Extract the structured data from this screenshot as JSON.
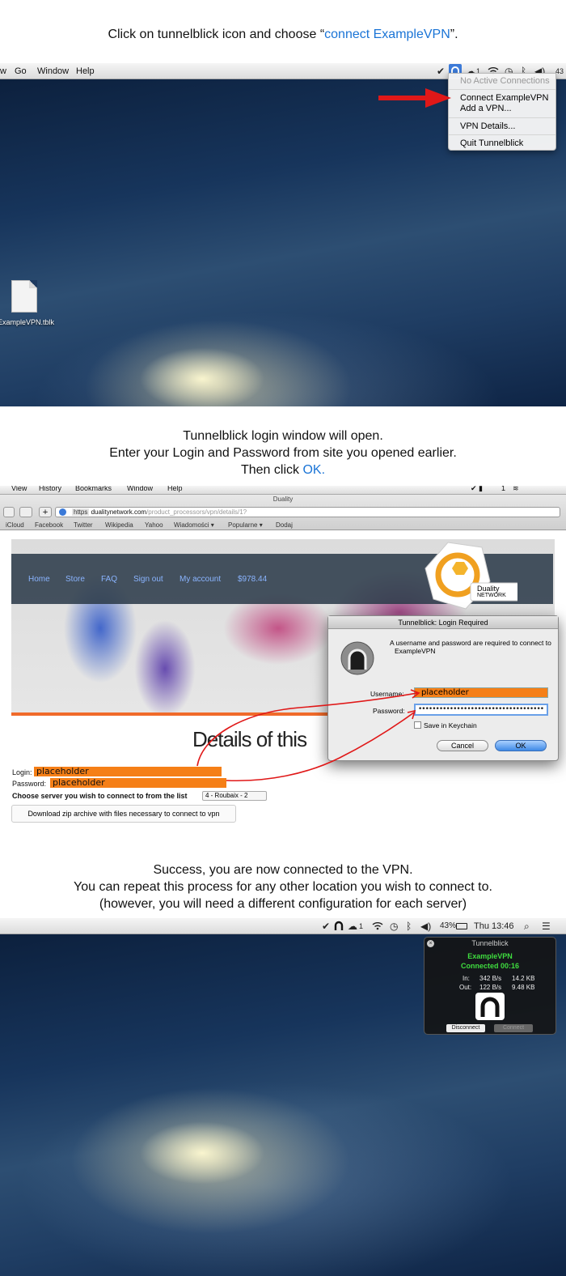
{
  "captions": {
    "step1_pre": "Click on tunnelblick icon and choose “",
    "step1_hl": "connect ExampleVPN",
    "step1_post": "”.",
    "step2_line1": "Tunnelblick login window will open.",
    "step2_line2": "Enter your Login and Password from site you opened earlier.",
    "step2_line3_pre": "Then click ",
    "step2_line3_hl": "OK.",
    "step3_line1": "Success, you are now connected to the VPN.",
    "step3_line2": "You can repeat this process for any other location you wish to connect to.",
    "step3_line3": "(however, you will need a different configuration for each server)"
  },
  "colors": {
    "highlight": "#1a74d6",
    "orange": "#f57f17",
    "arrow": "#e01818",
    "connected_green": "#3fdc3f"
  },
  "screen1": {
    "menubar": [
      "w",
      "Go",
      "Window",
      "Help"
    ],
    "tray_badge": "1",
    "tray_right": "43",
    "tunnelblick_menu": {
      "items": [
        "No Active Connections",
        "Connect ExampleVPN",
        "Add a VPN...",
        "VPN Details...",
        "Quit Tunnelblick"
      ]
    },
    "desktop_file": "ExampleVPN.tblk"
  },
  "screen2": {
    "menubar": [
      "View",
      "History",
      "Bookmarks",
      "Window",
      "Help"
    ],
    "tray_badge": "1",
    "window_title": "Duality",
    "url_scheme": "https",
    "url_host": "dualitynetwork.com",
    "url_path": "/product_processors/vpn/details/1?",
    "bookmarks": [
      "iCloud",
      "Facebook",
      "Twitter",
      "Wikipedia",
      "Yahoo",
      "Wiadomości ▾",
      "Popularne ▾",
      "Dodaj"
    ],
    "site_nav": [
      "Home",
      "Store",
      "FAQ",
      "Sign out",
      "My account",
      "$978.44"
    ],
    "logo_line1": "Duality",
    "logo_line2": "NETWORK",
    "heading": "Details of this",
    "login_label": "Login:",
    "login_value": "placeholder",
    "password_label": "Password:",
    "password_value": "placeholder",
    "server_label": "Choose server you wish to connect to from the list",
    "server_selected": "4 - Roubaix - 2",
    "download_button": "Download zip archive with files necessary to connect to vpn",
    "dialog": {
      "title": "Tunnelblick: Login Required",
      "message": "A username and password are required to connect to",
      "connection": "ExampleVPN",
      "username_label": "Username:",
      "username_value": "placeholder",
      "password_label": "Password:",
      "password_dots": "••••••••••••••••••••••••••••••••••••",
      "save_keychain": "Save in Keychain",
      "cancel": "Cancel",
      "ok": "OK"
    }
  },
  "screen3": {
    "tray_badge": "1",
    "battery": "43%",
    "clock": "Thu 13:46",
    "status_window": {
      "title": "Tunnelblick",
      "name": "ExampleVPN",
      "status": "Connected 00:16",
      "in_label": "In:",
      "in_rate": "342 B/s",
      "in_total": "14.2 KB",
      "out_label": "Out:",
      "out_rate": "122 B/s",
      "out_total": "9.48 KB",
      "disconnect": "Disconnect",
      "connect": "Connect"
    }
  }
}
